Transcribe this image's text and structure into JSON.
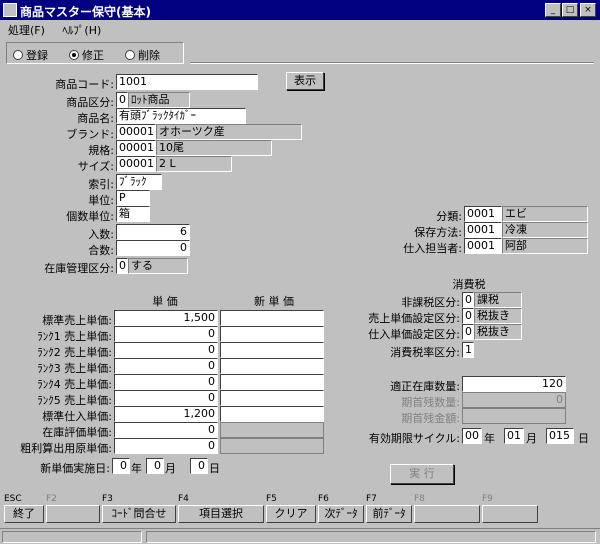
{
  "window": {
    "title": "商品マスター保守(基本)",
    "btn_min": "_",
    "btn_max": "□",
    "btn_close": "×"
  },
  "menu": {
    "process": "処理(F)",
    "help": "ﾍﾙﾌﾟ(H)"
  },
  "mode": {
    "register": "登録",
    "modify": "修正",
    "delete": "削除",
    "selected": "modify"
  },
  "fields": {
    "product_code": {
      "label": "商品コード:",
      "value": "1001"
    },
    "display_button": "表示",
    "product_category": {
      "label": "商品区分:",
      "code": "0",
      "name": "ﾛｯﾄ商品"
    },
    "product_name": {
      "label": "商品名:",
      "value": "有頭ﾌﾞﾗｯｸﾀｲｶﾞｰ"
    },
    "brand": {
      "label": "ブランド:",
      "code": "00001",
      "name": "オホーツク産"
    },
    "spec": {
      "label": "規格:",
      "code": "00001",
      "name": "10尾"
    },
    "size": {
      "label": "サイズ:",
      "code": "00001",
      "name": "2 L"
    },
    "index": {
      "label": "索引:",
      "value": "ﾌﾞﾗｯｸ"
    },
    "unit": {
      "label": "単位:",
      "value": "P"
    },
    "piece_unit": {
      "label": "個数単位:",
      "value": "箱"
    },
    "quantity_in": {
      "label": "入数:",
      "value": "6"
    },
    "total_count": {
      "label": "合数:",
      "value": "0"
    },
    "stock_mgmt": {
      "label": "在庫管理区分:",
      "code": "0",
      "name": "する"
    },
    "classification": {
      "label": "分類:",
      "code": "0001",
      "name": "エビ"
    },
    "storage": {
      "label": "保存方法:",
      "code": "0001",
      "name": "冷凍"
    },
    "buyer": {
      "label": "仕入担当者:",
      "code": "0001",
      "name": "阿部"
    }
  },
  "tax": {
    "heading": "消費税",
    "non_taxable": {
      "label": "非課税区分:",
      "code": "0",
      "name": "課税"
    },
    "sales_price_setting": {
      "label": "売上単価設定区分:",
      "code": "0",
      "name": "税抜き"
    },
    "purchase_price_setting": {
      "label": "仕入単価設定区分:",
      "code": "0",
      "name": "税抜き"
    },
    "tax_rate": {
      "label": "消費税率区分:",
      "code": "1"
    }
  },
  "prices": {
    "col_unit": "単 価",
    "col_new": "新 単 価",
    "rows": [
      {
        "label": "標準売上単価:",
        "value": "1,500",
        "new": ""
      },
      {
        "label": "ﾗﾝｸ1 売上単価:",
        "value": "0",
        "new": ""
      },
      {
        "label": "ﾗﾝｸ2 売上単価:",
        "value": "0",
        "new": ""
      },
      {
        "label": "ﾗﾝｸ3 売上単価:",
        "value": "0",
        "new": ""
      },
      {
        "label": "ﾗﾝｸ4 売上単価:",
        "value": "0",
        "new": ""
      },
      {
        "label": "ﾗﾝｸ5 売上単価:",
        "value": "0",
        "new": ""
      },
      {
        "label": "標準仕入単価:",
        "value": "1,200",
        "new": ""
      },
      {
        "label": "在庫評価単価:",
        "value": "0",
        "new": ""
      },
      {
        "label": "粗利算出用原単価:",
        "value": "0",
        "new": ""
      }
    ],
    "new_price_date": {
      "label": "新単価実施日:",
      "year": "0",
      "year_unit": "年",
      "month": "0",
      "month_unit": "月",
      "day": "0",
      "day_unit": "日"
    }
  },
  "inventory": {
    "optimal_stock": {
      "label": "適正在庫数量:",
      "value": "120"
    },
    "opening_qty": {
      "label": "期首残数量:",
      "value": "0"
    },
    "opening_amount": {
      "label": "期首残金額:",
      "value": ""
    },
    "expiry_cycle": {
      "label": "有効期限サイクル:",
      "year": "00",
      "year_unit": "年",
      "month": "01",
      "month_unit": "月",
      "day": "015",
      "day_unit": "日"
    }
  },
  "execute_button": "実 行",
  "function_keys": [
    {
      "key": "ESC",
      "label": "終了",
      "enabled": true
    },
    {
      "key": "F2",
      "label": "",
      "enabled": false
    },
    {
      "key": "F3",
      "label": "ｺｰﾄﾞ問合せ",
      "enabled": true
    },
    {
      "key": "F4",
      "label": "項目選択",
      "enabled": true
    },
    {
      "key": "F5",
      "label": "クリア",
      "enabled": true
    },
    {
      "key": "F6",
      "label": "次ﾃﾞｰﾀ",
      "enabled": true
    },
    {
      "key": "F7",
      "label": "前ﾃﾞｰﾀ",
      "enabled": true
    },
    {
      "key": "F8",
      "label": "",
      "enabled": false
    },
    {
      "key": "F9",
      "label": "",
      "enabled": false
    }
  ]
}
